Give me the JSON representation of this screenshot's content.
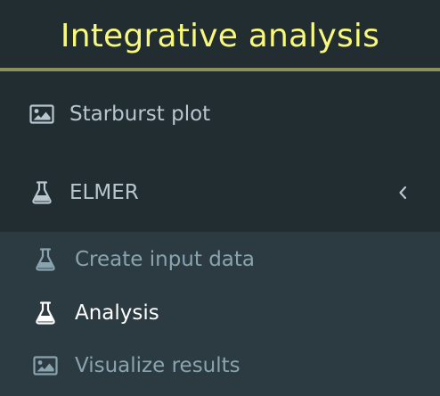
{
  "sidebar": {
    "header": {
      "title": "Integrative analysis"
    },
    "items": [
      {
        "label": "Starburst plot",
        "icon": "image-icon"
      },
      {
        "label": "ELMER",
        "icon": "flask-icon",
        "expanded": true,
        "toggle_icon": "chevron-left-icon"
      }
    ],
    "submenu": [
      {
        "label": "Create input data",
        "icon": "flask-icon",
        "active": false
      },
      {
        "label": "Analysis",
        "icon": "flask-icon",
        "active": true
      },
      {
        "label": "Visualize results",
        "icon": "image-icon",
        "active": false
      }
    ]
  },
  "colors": {
    "sidebar_bg": "#222d32",
    "submenu_bg": "#2c3b41",
    "header_title": "#f8f87a",
    "header_border": "#8b8f5c",
    "item_text": "#b8c7ce",
    "sub_item_text": "#8aa4af",
    "active_text": "#ffffff"
  }
}
